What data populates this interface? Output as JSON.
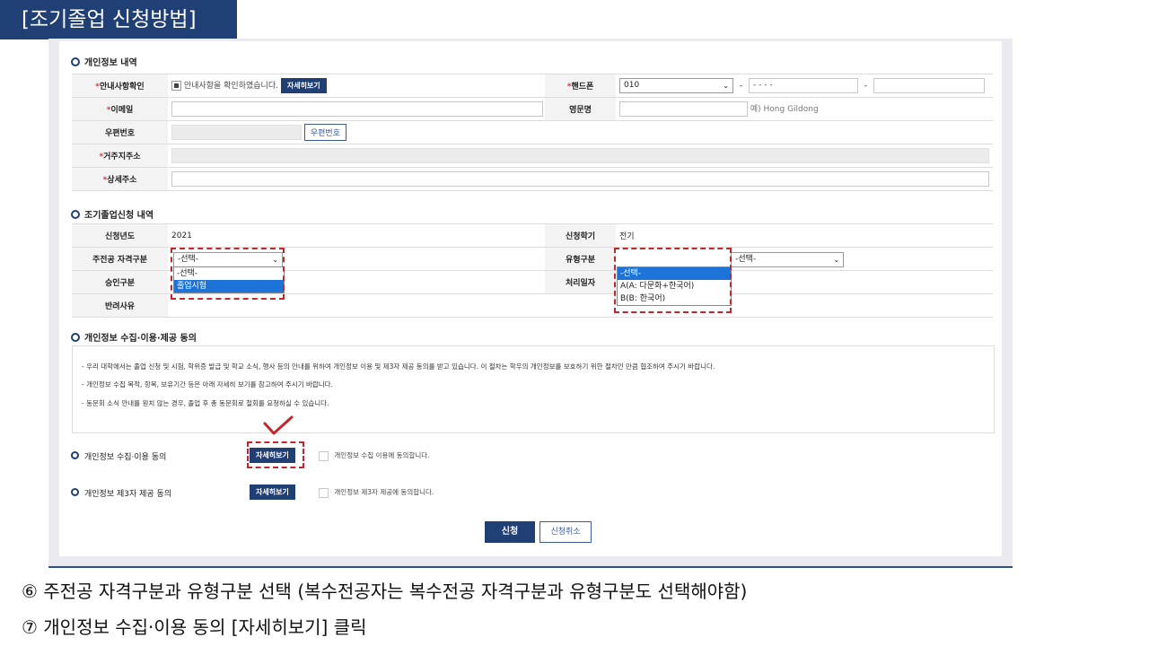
{
  "slide": {
    "title": "[조기졸업 신청방법]",
    "notes": [
      "⑥ 주전공 자격구분과 유형구분 선택 (복수전공자는 복수전공 자격구분과 유형구분도 선택해야함)",
      "⑦ 개인정보 수집·이용 동의 [자세히보기] 클릭"
    ]
  },
  "personal": {
    "section_title": "개인정보 내역",
    "notice_label": "안내사항확인",
    "notice_text": "안내사항을 확인하였습니다.",
    "detail_button": "자세히보기",
    "phone_label": "핸드폰",
    "phone_prefix": "010",
    "phone_middle": "- - - -",
    "dash": "-",
    "email_label": "이메일",
    "english_name_label": "영문명",
    "english_name_hint": "예) Hong Gildong",
    "zipcode_label": "우편번호",
    "zipcode_button": "우편번호",
    "address_label": "거주지주소",
    "detail_address_label": "상세주소",
    "required_mark": "*"
  },
  "application": {
    "section_title": "조기졸업신청 내역",
    "year_label": "신청년도",
    "year_value": "2021",
    "semester_label": "신청학기",
    "semester_value": "전기",
    "major_qual_label": "주전공 자격구분",
    "major_qual_value": "-선택-",
    "major_qual_options": [
      "-선택-",
      "졸업시험"
    ],
    "type_label": "유형구분",
    "type_value": "-선택-",
    "type_options": [
      "-선택-",
      "A(A: 다문화+한국어)",
      "B(B: 한국어)"
    ],
    "approval_label": "승인구분",
    "process_date_label": "처리일자",
    "reject_reason_label": "반려사유"
  },
  "consent": {
    "section_title": "개인정보 수집·이용·제공 동의",
    "lines": [
      "- 우리 대학에서는 졸업 신청 및 시험, 학위증 발급 및 학교 소식, 행사 등의 안내를 위하여 개인정보 이용 및 제3자 제공 동의를 받고 있습니다. 이 절차는 학우의 개인정보를 보호하기 위한 절차인 만큼 협조하여 주시기 바랍니다.",
      "- 개인정보 수집 목적, 항목, 보유기간 등은 아래 자세히 보기를 참고하여 주시기 바랍니다.",
      "- 동문회 소식 안내를 원치 않는 경우, 졸업 후 총 동문회로 철회를 요청하실 수 있습니다."
    ],
    "use_label": "개인정보 수집·이용 동의",
    "use_button": "자세히보기",
    "use_agree": "개인정보 수집 이용에 동의합니다.",
    "third_label": "개인정보 제3자 제공 동의",
    "third_button": "자세히보기",
    "third_agree": "개인정보 제3자 제공에 동의합니다."
  },
  "actions": {
    "submit": "신청",
    "cancel": "신청취소"
  },
  "colors": {
    "navy": "#1f3f75",
    "highlight_red": "#c0282d",
    "select_blue": "#1e73d8"
  }
}
